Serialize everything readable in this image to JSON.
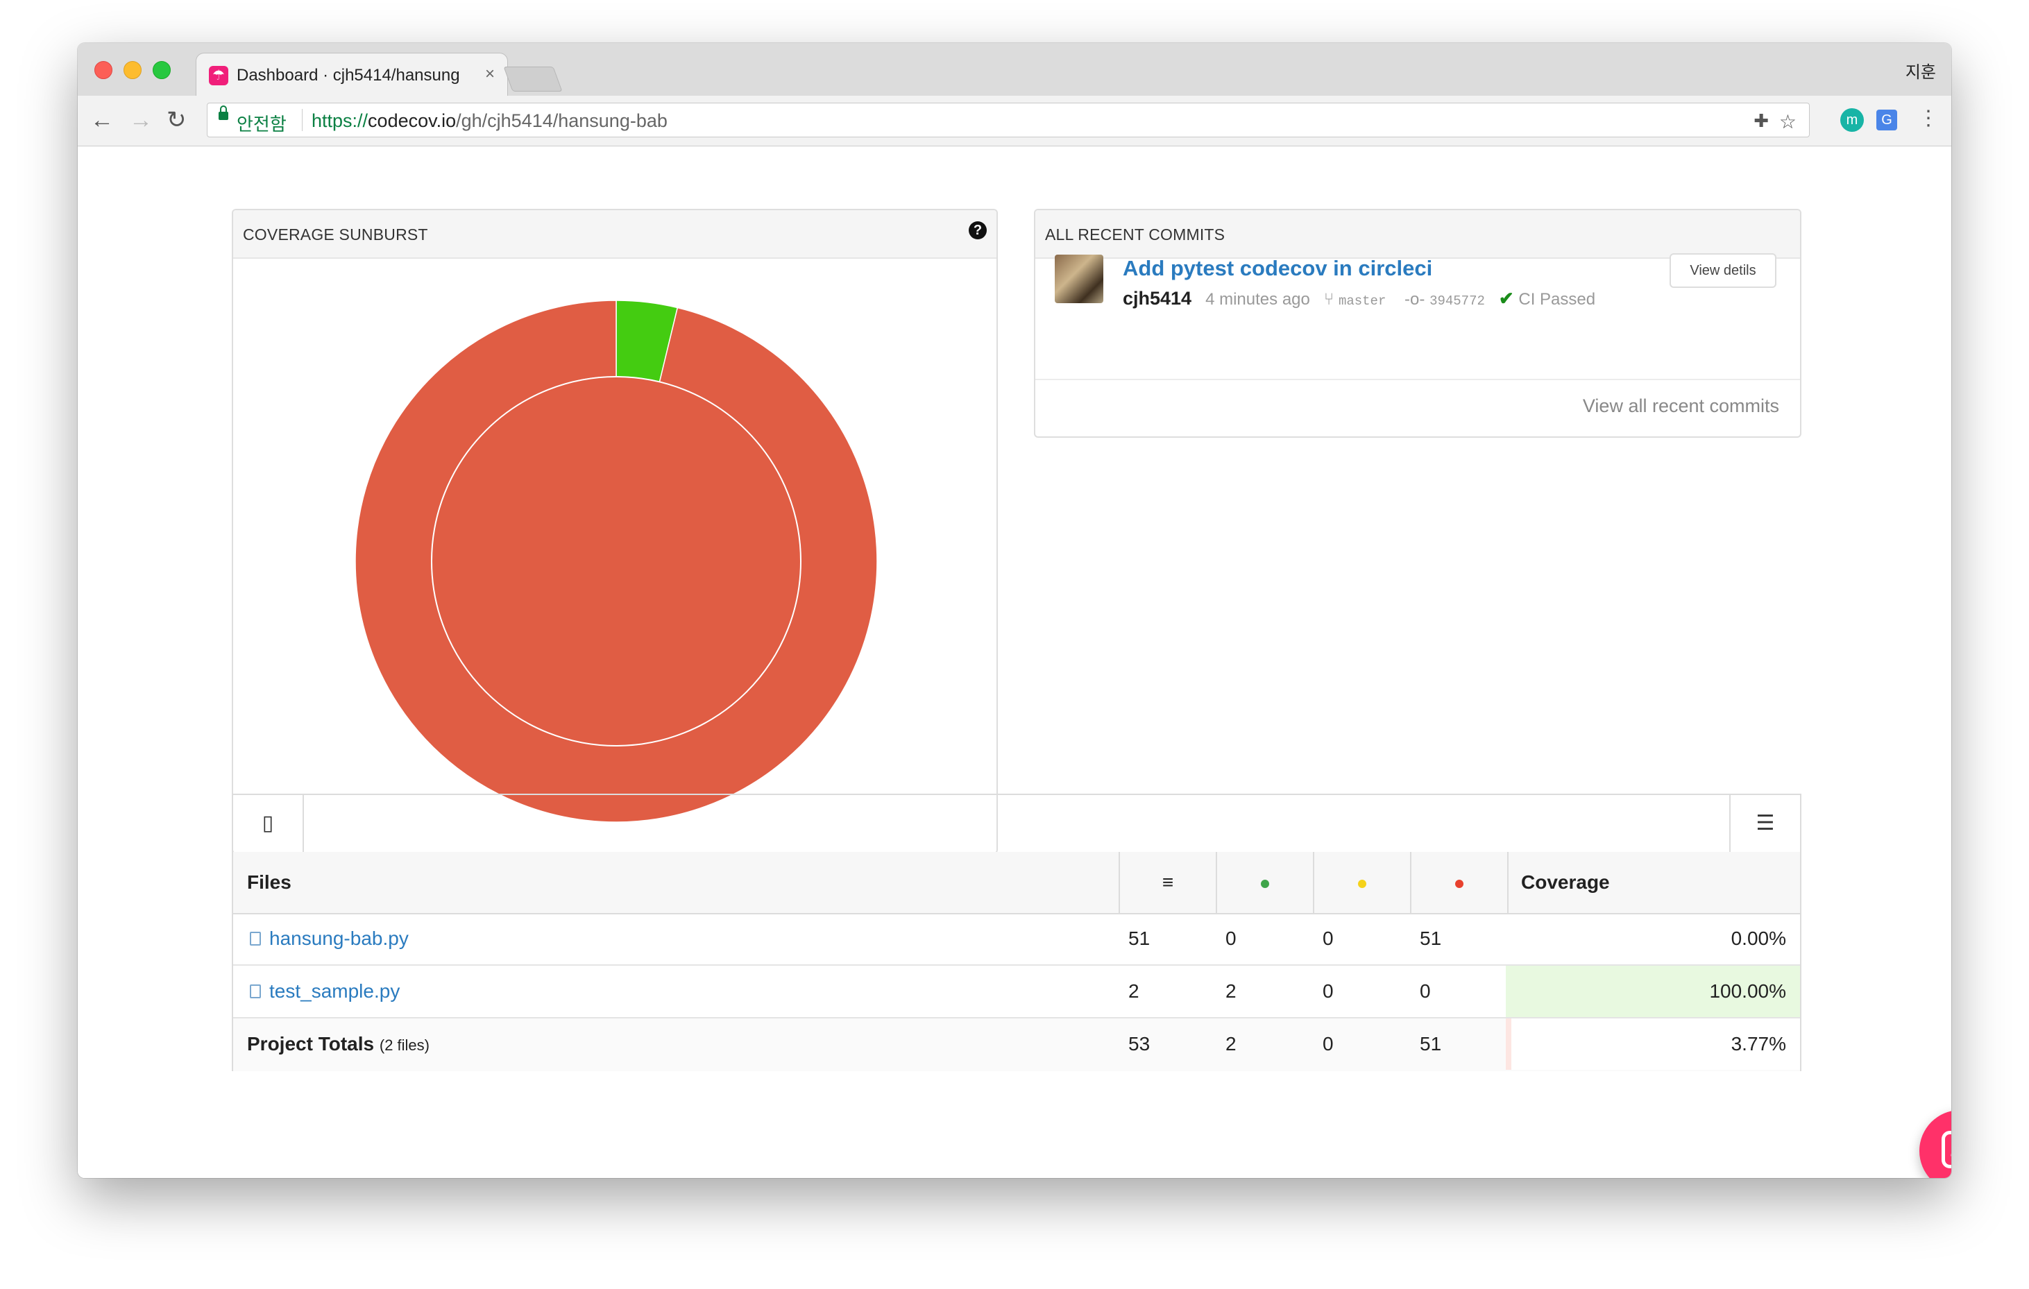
{
  "browser": {
    "tab_title": "Dashboard · cjh5414/hansung",
    "tab_close": "×",
    "profile_name": "지훈",
    "secure_label": "안전함",
    "url_scheme": "https://",
    "url_host": "codecov.io",
    "url_path": "/gh/cjh5414/hansung-bab",
    "nav": {
      "back": "←",
      "forward": "→",
      "reload": "↻"
    },
    "icons": [
      "puzzle-icon",
      "star-icon",
      "extension-m-icon",
      "translate-icon",
      "menu-dots-icon"
    ]
  },
  "sunburst": {
    "title": "COVERAGE SUNBURST",
    "help": "?",
    "colors": {
      "covered": "#44cc11",
      "missed": "#e05d44",
      "stroke": "#ffffff"
    },
    "outer_ring": [
      {
        "label": "test_sample.py",
        "coverage": 100.0,
        "lines": 2
      },
      {
        "label": "hansung-bab.py",
        "coverage": 0.0,
        "lines": 51
      }
    ],
    "inner_coverage": 3.77
  },
  "commits": {
    "title": "ALL RECENT COMMITS",
    "items": [
      {
        "message": "Add pytest codecov in circleci",
        "author": "cjh5414",
        "time": "4 minutes ago",
        "branch": "master",
        "sha": "3945772",
        "ci_status": "CI Passed",
        "view_button": "View detils"
      }
    ],
    "view_all": "View all recent commits"
  },
  "files_table": {
    "headers": {
      "files": "Files",
      "lines_icon": "≡",
      "hit_color": "#3fa54a",
      "partial_color": "#f5d21a",
      "miss_color": "#e8412e",
      "coverage": "Coverage"
    },
    "rows": [
      {
        "name": "hansung-bab.py",
        "lines": "51",
        "hits": "0",
        "partials": "0",
        "misses": "51",
        "coverage": "0.00%",
        "coverage_value": 0.0
      },
      {
        "name": "test_sample.py",
        "lines": "2",
        "hits": "2",
        "partials": "0",
        "misses": "0",
        "coverage": "100.00%",
        "coverage_value": 100.0
      }
    ],
    "totals": {
      "label": "Project Totals",
      "sub": "(2 files)",
      "lines": "53",
      "hits": "2",
      "partials": "0",
      "misses": "51",
      "coverage": "3.77%",
      "coverage_value": 3.77
    }
  }
}
